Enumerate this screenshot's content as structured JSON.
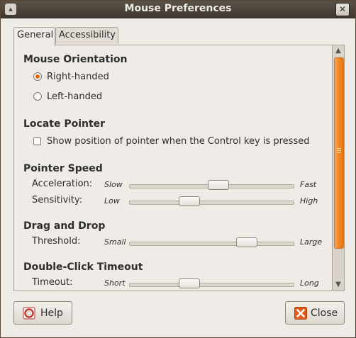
{
  "window": {
    "title": "Mouse Preferences"
  },
  "tabs": [
    {
      "label": "General",
      "active": true
    },
    {
      "label": "Accessibility",
      "active": false
    }
  ],
  "orientation": {
    "heading": "Mouse Orientation",
    "right_label": "Right-handed",
    "left_label": "Left-handed",
    "selected": "Right-handed"
  },
  "locate": {
    "heading": "Locate Pointer",
    "checkbox_label": "Show position of pointer when the Control key is pressed",
    "checked": false
  },
  "speed": {
    "heading": "Pointer Speed",
    "acceleration": {
      "label": "Acceleration:",
      "low": "Slow",
      "high": "Fast",
      "value": 0.55
    },
    "sensitivity": {
      "label": "Sensitivity:",
      "low": "Low",
      "high": "High",
      "value": 0.35
    }
  },
  "dragdrop": {
    "heading": "Drag and Drop",
    "threshold": {
      "label": "Threshold:",
      "low": "Small",
      "high": "Large",
      "value": 0.75
    }
  },
  "doubleclick": {
    "heading": "Double-Click Timeout",
    "timeout": {
      "label": "Timeout:",
      "low": "Short",
      "high": "Long",
      "value": 0.35
    }
  },
  "buttons": {
    "help": "Help",
    "close": "Close"
  },
  "colors": {
    "accent": "#e06c12",
    "close_icon": "#e05a1a"
  }
}
